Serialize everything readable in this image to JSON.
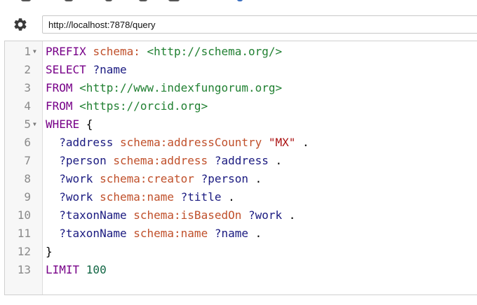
{
  "toolbar": {
    "settings_icon": "gear-icon",
    "endpoint_url": "http://localhost:7878/query"
  },
  "editor": {
    "fold_icon": "fold-arrow-icon",
    "lines": [
      {
        "num": "1",
        "fold": true,
        "indent": "",
        "tokens": [
          {
            "t": "PREFIX ",
            "c": "kw"
          },
          {
            "t": "schema: ",
            "c": "pf"
          },
          {
            "t": "<http://schema.org/>",
            "c": "iri"
          }
        ]
      },
      {
        "num": "2",
        "fold": false,
        "indent": "",
        "tokens": [
          {
            "t": "SELECT ",
            "c": "kw"
          },
          {
            "t": "?name",
            "c": "var"
          }
        ]
      },
      {
        "num": "3",
        "fold": false,
        "indent": "",
        "tokens": [
          {
            "t": "FROM ",
            "c": "kw"
          },
          {
            "t": "<http://www.indexfungorum.org>",
            "c": "iri"
          }
        ]
      },
      {
        "num": "4",
        "fold": false,
        "indent": "",
        "tokens": [
          {
            "t": "FROM ",
            "c": "kw"
          },
          {
            "t": "<https://orcid.org>",
            "c": "iri"
          }
        ]
      },
      {
        "num": "5",
        "fold": true,
        "indent": "",
        "tokens": [
          {
            "t": "WHERE ",
            "c": "kw"
          },
          {
            "t": "{",
            "c": "plain"
          }
        ]
      },
      {
        "num": "6",
        "fold": false,
        "indent": "  ",
        "tokens": [
          {
            "t": "?address ",
            "c": "var"
          },
          {
            "t": "schema:addressCountry ",
            "c": "pf"
          },
          {
            "t": "\"MX\"",
            "c": "str"
          },
          {
            "t": " .",
            "c": "plain"
          }
        ]
      },
      {
        "num": "7",
        "fold": false,
        "indent": "  ",
        "tokens": [
          {
            "t": "?person ",
            "c": "var"
          },
          {
            "t": "schema:address ",
            "c": "pf"
          },
          {
            "t": "?address",
            "c": "var"
          },
          {
            "t": " .",
            "c": "plain"
          }
        ]
      },
      {
        "num": "8",
        "fold": false,
        "indent": "  ",
        "tokens": [
          {
            "t": "?work ",
            "c": "var"
          },
          {
            "t": "schema:creator ",
            "c": "pf"
          },
          {
            "t": "?person",
            "c": "var"
          },
          {
            "t": " .",
            "c": "plain"
          }
        ]
      },
      {
        "num": "9",
        "fold": false,
        "indent": "  ",
        "tokens": [
          {
            "t": "?work ",
            "c": "var"
          },
          {
            "t": "schema:name ",
            "c": "pf"
          },
          {
            "t": "?title",
            "c": "var"
          },
          {
            "t": " .",
            "c": "plain"
          }
        ]
      },
      {
        "num": "10",
        "fold": false,
        "indent": "  ",
        "tokens": [
          {
            "t": "?taxonName ",
            "c": "var"
          },
          {
            "t": "schema:isBasedOn ",
            "c": "pf"
          },
          {
            "t": "?work",
            "c": "var"
          },
          {
            "t": " .",
            "c": "plain"
          }
        ]
      },
      {
        "num": "11",
        "fold": false,
        "indent": "  ",
        "tokens": [
          {
            "t": "?taxonName ",
            "c": "var"
          },
          {
            "t": "schema:name ",
            "c": "pf"
          },
          {
            "t": "?name",
            "c": "var"
          },
          {
            "t": " .",
            "c": "plain"
          }
        ]
      },
      {
        "num": "12",
        "fold": false,
        "indent": "",
        "tokens": [
          {
            "t": "}",
            "c": "plain"
          }
        ]
      },
      {
        "num": "13",
        "fold": false,
        "indent": "",
        "tokens": [
          {
            "t": "LIMIT ",
            "c": "kw"
          },
          {
            "t": "100",
            "c": "num"
          }
        ]
      }
    ]
  }
}
